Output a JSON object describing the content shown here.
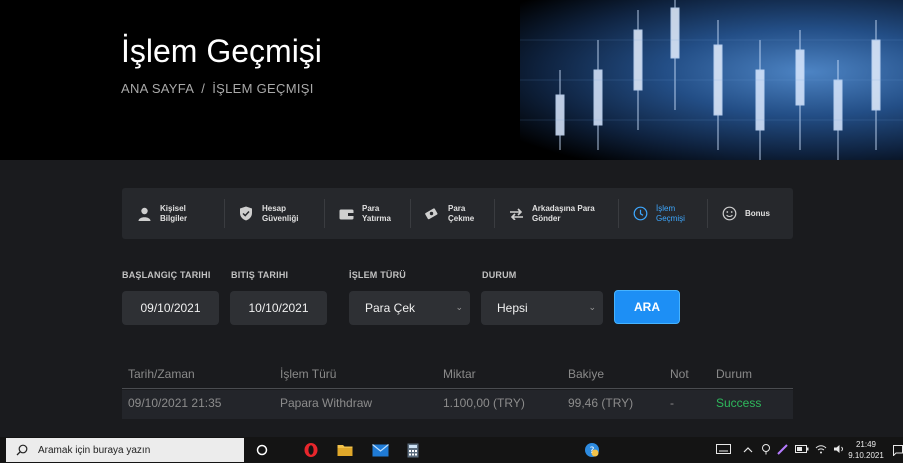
{
  "hero": {
    "title": "İşlem Geçmişi",
    "breadcrumb": {
      "home": "ANA SAYFA",
      "separator": "/",
      "current": "İŞLEM GEÇMIŞI"
    }
  },
  "tabs": [
    {
      "label": "Kişisel\nBilgiler",
      "icon": "user-icon",
      "active": false
    },
    {
      "label": "Hesap\nGüvenliği",
      "icon": "shield-icon",
      "active": false
    },
    {
      "label": "Para\nYatırma",
      "icon": "wallet-icon",
      "active": false
    },
    {
      "label": "Para\nÇekme",
      "icon": "cash-icon",
      "active": false
    },
    {
      "label": "Arkadaşına Para\nGönder",
      "icon": "transfer-icon",
      "active": false
    },
    {
      "label": "İşlem\nGeçmişi",
      "icon": "history-icon",
      "active": true
    },
    {
      "label": "Bonus",
      "icon": "smiley-icon",
      "active": false
    }
  ],
  "filters": {
    "start_label": "BAŞLANGIÇ TARIHI",
    "start_value": "09/10/2021",
    "end_label": "BITIŞ TARIHI",
    "end_value": "10/10/2021",
    "type_label": "İŞLEM TÜRÜ",
    "type_value": "Para Çek",
    "status_label": "DURUM",
    "status_value": "Hepsi",
    "search_button": "ARA"
  },
  "table": {
    "columns": [
      "Tarih/Zaman",
      "İşlem Türü",
      "Miktar",
      "Bakiye",
      "Not",
      "Durum"
    ],
    "rows": [
      [
        "09/10/2021 21:35",
        "Papara Withdraw",
        "1.100,00 (TRY)",
        "99,46 (TRY)",
        "-",
        "Success"
      ]
    ]
  },
  "taskbar": {
    "search_placeholder": "Aramak için buraya yazın",
    "time": "21:49",
    "date": "9.10.2021"
  },
  "colors": {
    "accent": "#1d8ff5",
    "active_tab": "#3ea8ff",
    "success": "#2eb85c",
    "background": "#1a1b1e"
  }
}
